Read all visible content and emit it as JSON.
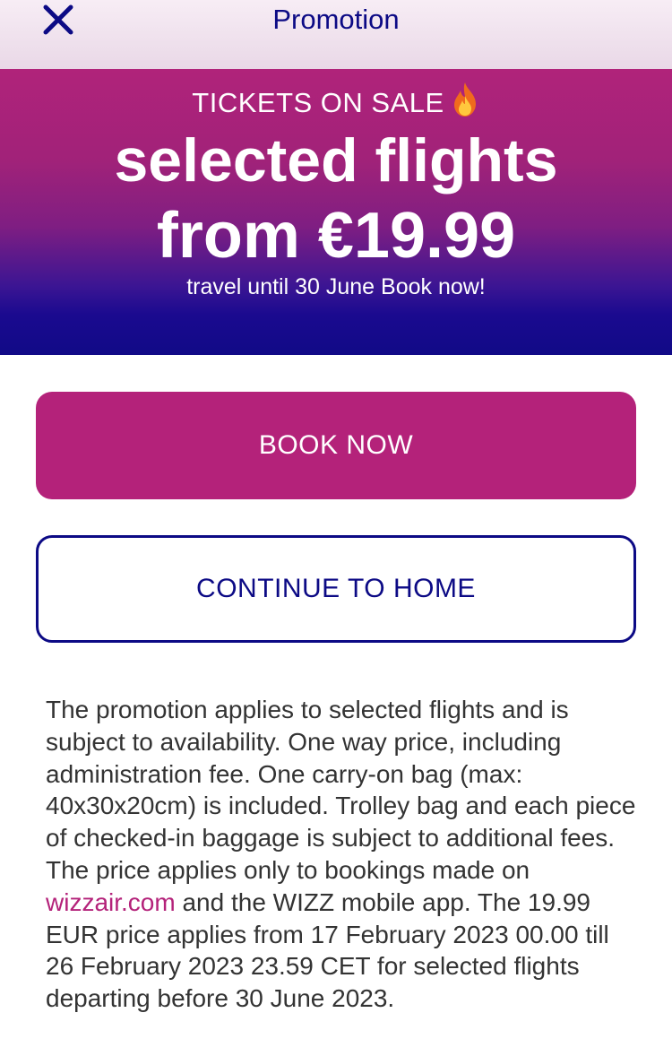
{
  "header": {
    "title": "Promotion",
    "close_icon": "close-icon"
  },
  "hero": {
    "kicker": "TICKETS ON SALE",
    "kicker_icon": "fire-icon",
    "headline_line1": "selected flights",
    "headline_line2": "from €19.99",
    "subline": "travel until 30 June Book now!"
  },
  "actions": {
    "book_now_label": "BOOK NOW",
    "continue_home_label": "CONTINUE TO HOME"
  },
  "terms": {
    "text_before_link": "The promotion applies to selected flights and is subject to availability. One way price, including administration fee. One carry-on bag (max: 40x30x20cm) is included. Trolley bag and each piece of checked-in baggage is subject to additional fees. The price applies only to bookings made on ",
    "link_text": "wizzair.com",
    "text_after_link": " and the WIZZ mobile app. The 19.99 EUR price applies from 17 February 2023 00.00 till 26 February 2023 23.59 CET for selected flights departing before 30 June 2023."
  },
  "colors": {
    "brand_navy": "#0c0a85",
    "brand_magenta": "#b4227a"
  }
}
